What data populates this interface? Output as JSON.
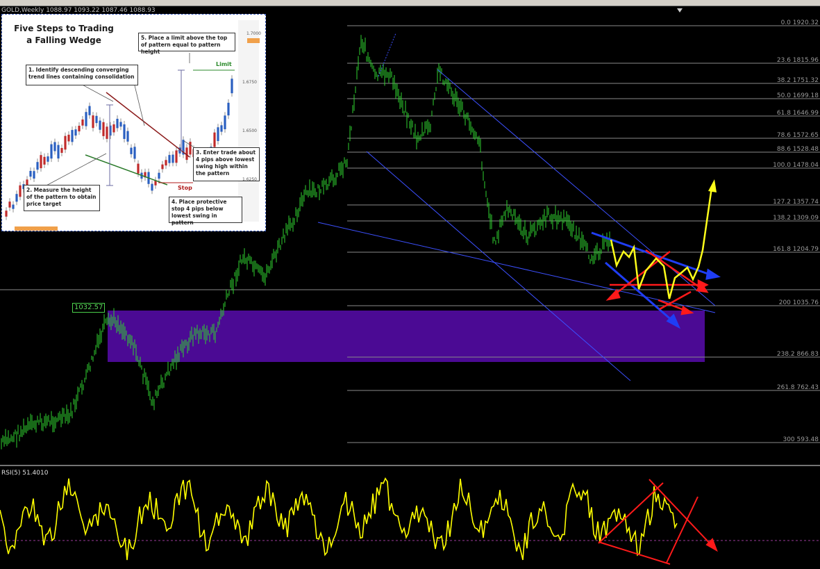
{
  "chart_header": {
    "text": "GOLD,Weekly  1088.97 1093.22 1087.46 1088.93"
  },
  "price_marker": {
    "label": "1032.57"
  },
  "fib_levels": [
    {
      "label": "0.0  1920.32"
    },
    {
      "label": "23.6  1815.96"
    },
    {
      "label": "38.2  1751.32"
    },
    {
      "label": "50.0  1699.18"
    },
    {
      "label": "61.8  1646.99"
    },
    {
      "label": "78.6  1572.65"
    },
    {
      "label": "88.6  1528.48"
    },
    {
      "label": "100.0  1478.04"
    },
    {
      "label": "127.2  1357.74"
    },
    {
      "label": "138.2  1309.09"
    },
    {
      "label": "161.8  1204.79"
    },
    {
      "label": "200  1035.76"
    },
    {
      "label": "238.2  866.83"
    },
    {
      "label": "261.8  762.43"
    },
    {
      "label": "300  593.48"
    }
  ],
  "rsi_panel": {
    "label": "RSI(5) 51.4010"
  },
  "inset": {
    "title": "Five Steps to Trading a Falling Wedge",
    "step1": "1. Identify descending converging trend lines containing consolidation",
    "step2": "2. Measure the height of the pattern to obtain price target",
    "step3": "3. Enter trade about 4 pips above lowest swing high within the pattern",
    "step4": "4. Place protective stop 4 pips below lowest swing in pattern",
    "step5": "5. Place a limit above the top of pattern equal to pattern height",
    "limit_label": "Limit",
    "stop_label": "Stop",
    "axis_labels": [
      "1.7000",
      "1.6750",
      "1.6500",
      "1.6250"
    ]
  },
  "colors": {
    "candles": "#2fd22f",
    "fib_lines": "#8a8a8a",
    "zone": "#4b0a94",
    "wedge_blue": "#1f3df5",
    "trend_lines": "#3c50ff",
    "marks_red": "#ff1a1a",
    "path_yellow": "#ffff1a",
    "rsi": "#ffff00"
  }
}
